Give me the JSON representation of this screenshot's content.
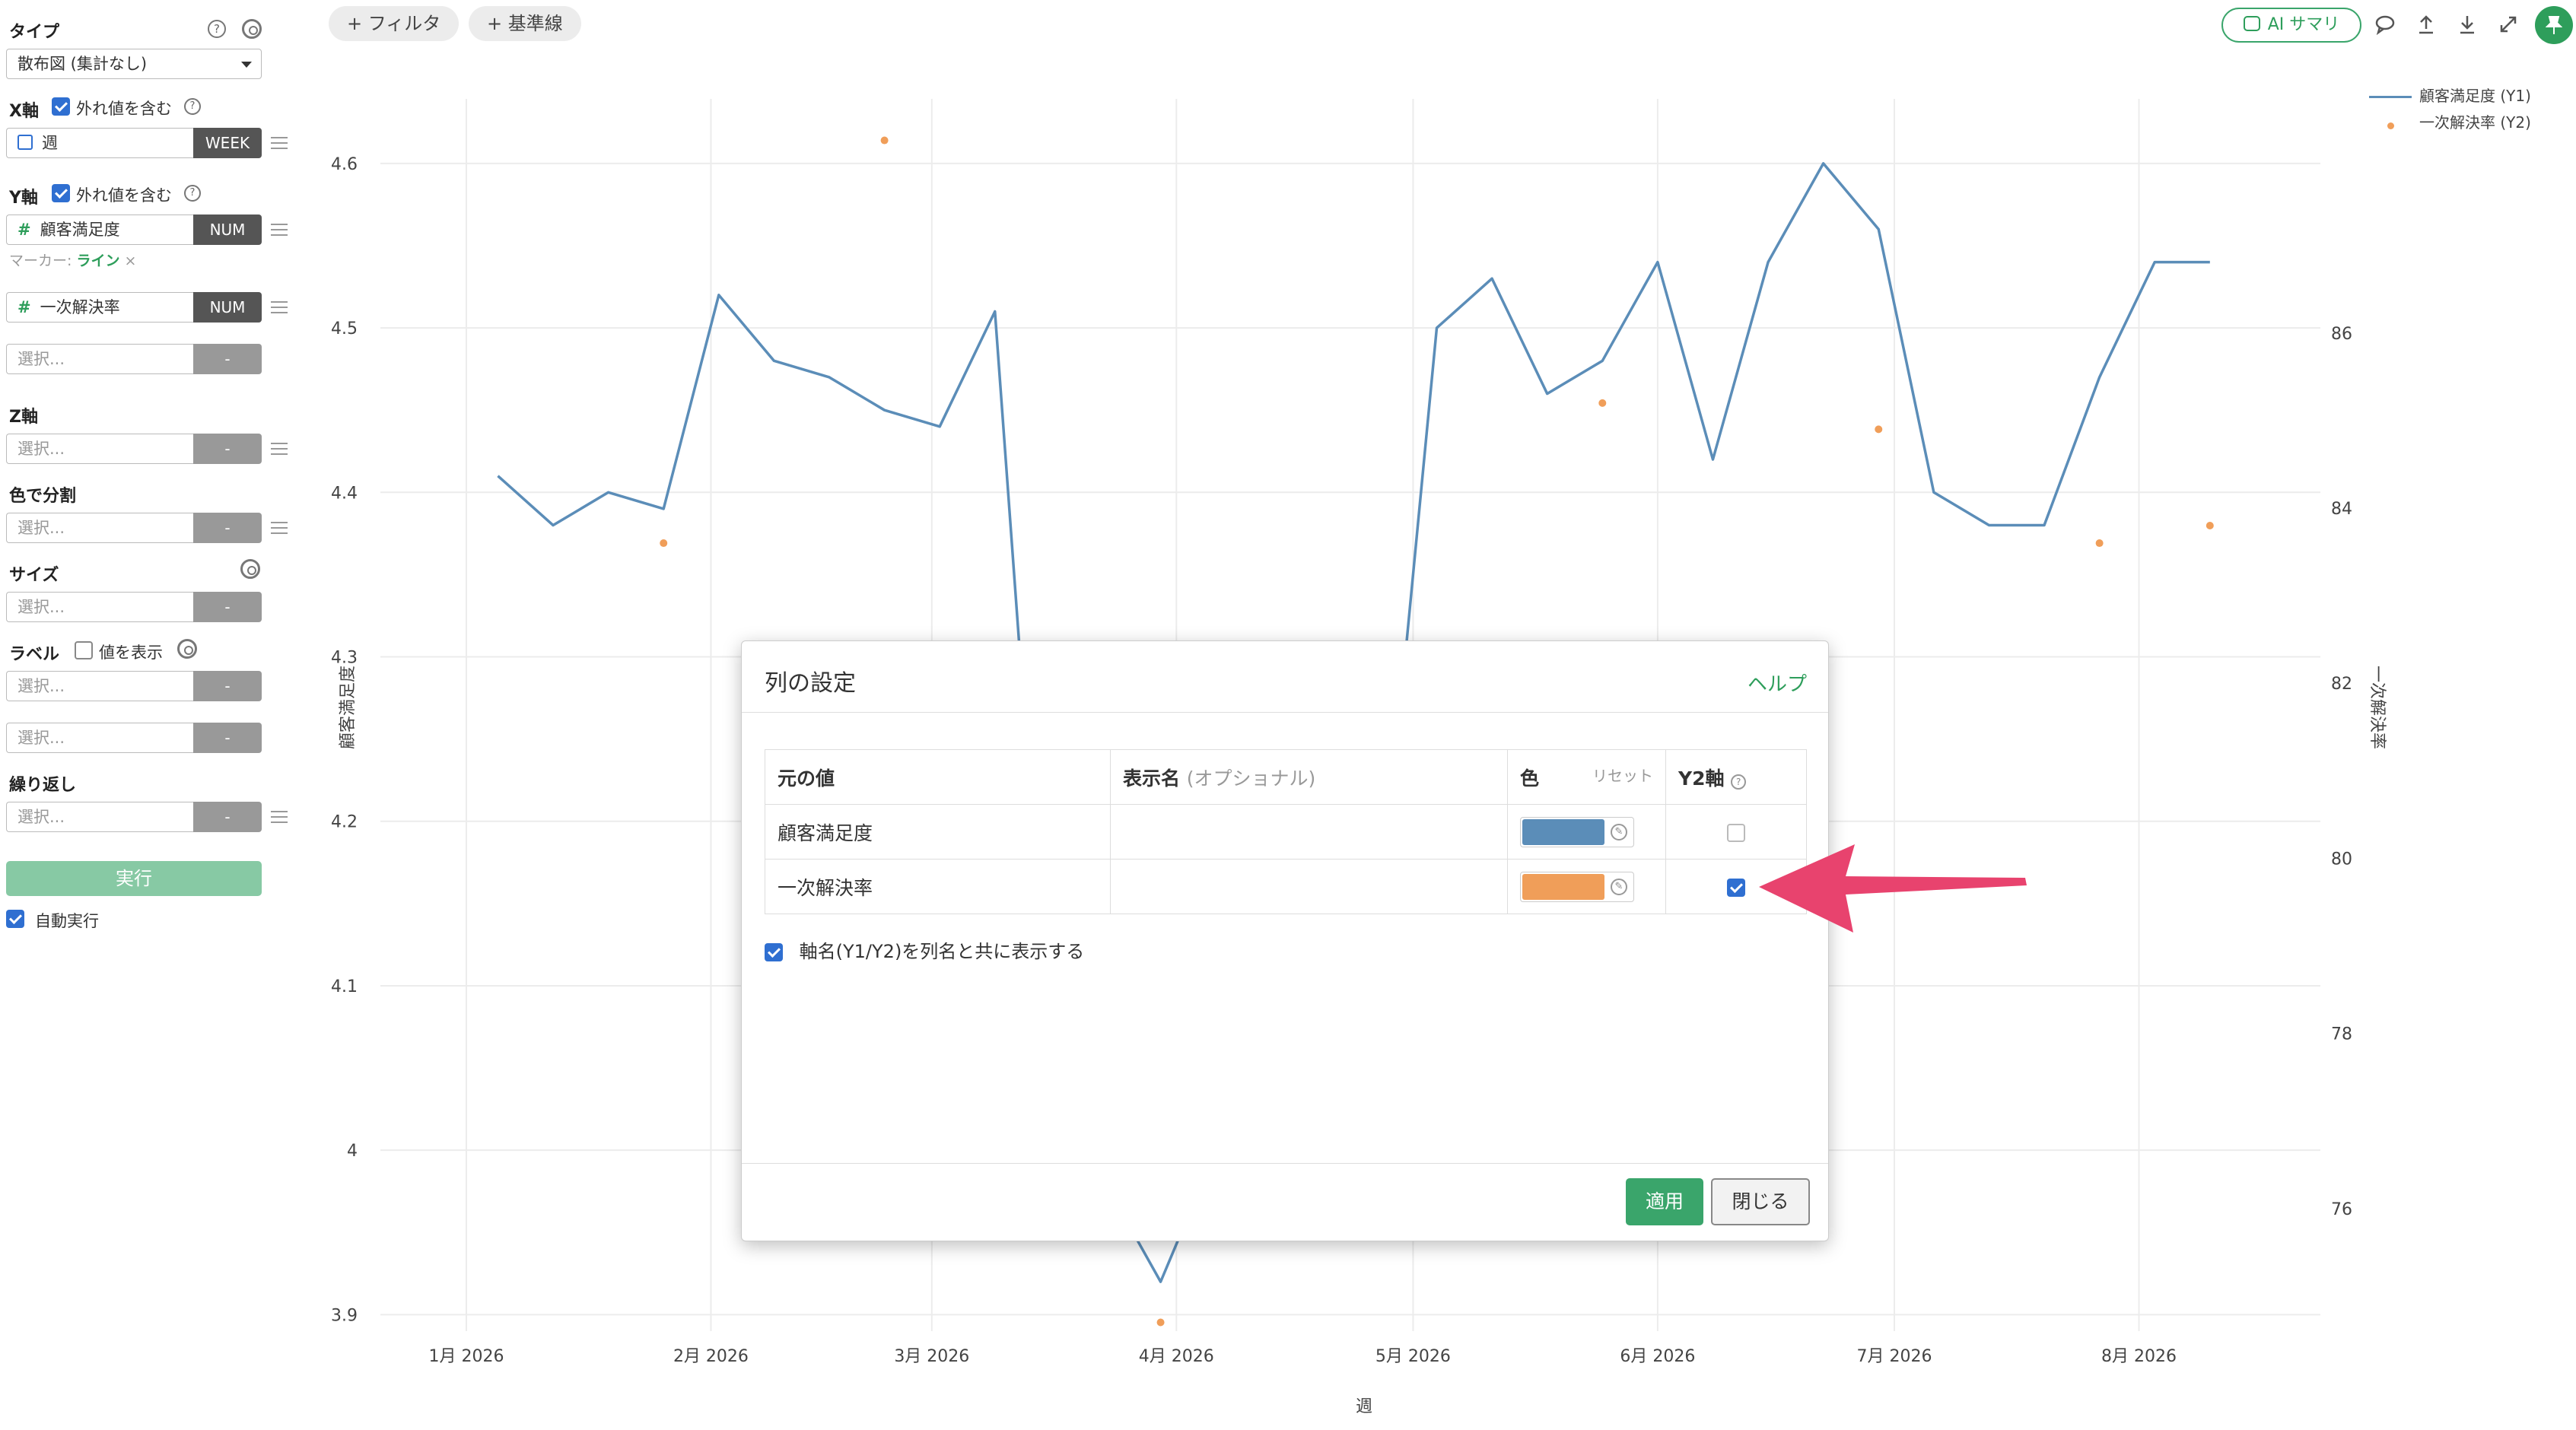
{
  "sidebar": {
    "type_label": "タイプ",
    "type_value": "散布図 (集計なし)",
    "x_axis": {
      "label": "X軸",
      "outliers_label": "外れ値を含む",
      "outliers_checked": true,
      "field": "週",
      "field_tag": "WEEK"
    },
    "y_axis": {
      "label": "Y軸",
      "outliers_label": "外れ値を含む",
      "outliers_checked": true,
      "field1": "顧客満足度",
      "field1_tag": "NUM",
      "marker_label": "マーカー:",
      "marker_value": "ライン",
      "marker_remove": "×",
      "field2": "一次解決率",
      "field2_tag": "NUM",
      "field3_placeholder": "選択...",
      "field3_tag": "-"
    },
    "z_axis": {
      "label": "Z軸",
      "placeholder": "選択...",
      "tag": "-"
    },
    "color_split": {
      "label": "色で分割",
      "placeholder": "選択...",
      "tag": "-"
    },
    "size": {
      "label": "サイズ",
      "placeholder": "選択...",
      "tag": "-"
    },
    "label": {
      "label": "ラベル",
      "show_values_label": "値を表示",
      "show_values_checked": false,
      "placeholder1": "選択...",
      "tag1": "-",
      "placeholder2": "選択...",
      "tag2": "-"
    },
    "repeat": {
      "label": "繰り返し",
      "placeholder": "選択...",
      "tag": "-"
    },
    "run_label": "実行",
    "auto_run_label": "自動実行",
    "auto_run_checked": true
  },
  "toolbar": {
    "filter_label": "+ フィルタ",
    "baseline_label": "+ 基準線",
    "ai_summary_label": "AI サマリ",
    "icons": [
      "comment-icon",
      "upload-icon",
      "download-icon",
      "expand-icon",
      "pin-icon"
    ]
  },
  "legend": {
    "y1_label": "顧客満足度 (Y1)",
    "y2_label": "一次解決率 (Y2)"
  },
  "chart_data": {
    "type": "line",
    "xlabel": "週",
    "ylabel": "顧客満足度",
    "y2label": "一次解決率",
    "x_ticks": [
      "1月 2026",
      "2月 2026",
      "3月 2026",
      "4月 2026",
      "5月 2026",
      "6月 2026",
      "7月 2026",
      "8月 2026"
    ],
    "y_ticks": [
      "4.6",
      "4.5",
      "4.4",
      "4.3",
      "4.2",
      "4.1",
      "4",
      "3.9"
    ],
    "y2_ticks": [
      "86",
      "84",
      "82",
      "80",
      "78",
      "76"
    ],
    "ylim": [
      3.89,
      4.63
    ],
    "y2lim": [
      74.6,
      88.5
    ],
    "grid": true,
    "legend_position": "top-right",
    "series": [
      {
        "name": "顧客満足度 (Y1)",
        "axis": "y1",
        "color": "#5b8db8",
        "style": "line",
        "x": [
          "2026-01-05",
          "2026-01-12",
          "2026-01-19",
          "2026-01-26",
          "2026-02-02",
          "2026-02-09",
          "2026-02-16",
          "2026-02-23",
          "2026-03-02",
          "2026-03-09",
          "2026-03-16",
          "2026-03-23",
          "2026-03-30",
          "2026-04-06",
          "2026-04-13",
          "2026-04-20",
          "2026-04-27",
          "2026-05-04",
          "2026-05-11",
          "2026-05-18",
          "2026-05-25",
          "2026-06-01",
          "2026-06-08",
          "2026-06-15",
          "2026-06-22",
          "2026-06-29",
          "2026-07-06",
          "2026-07-13",
          "2026-07-20",
          "2026-07-27",
          "2026-08-03",
          "2026-08-10"
        ],
        "values": [
          4.41,
          4.38,
          4.4,
          4.39,
          4.52,
          4.48,
          4.47,
          4.45,
          4.44,
          4.51,
          4.05,
          3.98,
          3.92,
          4.0,
          4.05,
          4.1,
          4.15,
          4.5,
          4.53,
          4.46,
          4.48,
          4.54,
          4.42,
          4.54,
          4.6,
          4.56,
          4.4,
          4.38,
          4.38,
          4.47,
          4.54,
          4.54
        ]
      },
      {
        "name": "一次解決率 (Y2)",
        "axis": "y2",
        "color": "#f09e59",
        "style": "points",
        "x": [
          "2026-01-26",
          "2026-02-23",
          "2026-03-30",
          "2026-05-25",
          "2026-06-29",
          "2026-07-27",
          "2026-08-10"
        ],
        "values": [
          83.6,
          88.2,
          74.7,
          85.2,
          84.9,
          83.6,
          83.8
        ]
      }
    ]
  },
  "dialog": {
    "title": "列の設定",
    "help_label": "ヘルプ",
    "col_source": "元の値",
    "col_display": "表示名",
    "col_display_optional": "(オプショナル)",
    "col_color": "色",
    "col_color_reset": "リセット",
    "col_y2": "Y2軸",
    "rows": [
      {
        "source": "顧客満足度",
        "display": "",
        "color": "#5b8db8",
        "y2": false
      },
      {
        "source": "一次解決率",
        "display": "",
        "color": "#f09e59",
        "y2": true
      }
    ],
    "show_axis_name_label": "軸名(Y1/Y2)を列名と共に表示する",
    "show_axis_name_checked": true,
    "apply_label": "適用",
    "close_label": "閉じる"
  },
  "annotation": {
    "arrow_color": "#e8436e"
  }
}
